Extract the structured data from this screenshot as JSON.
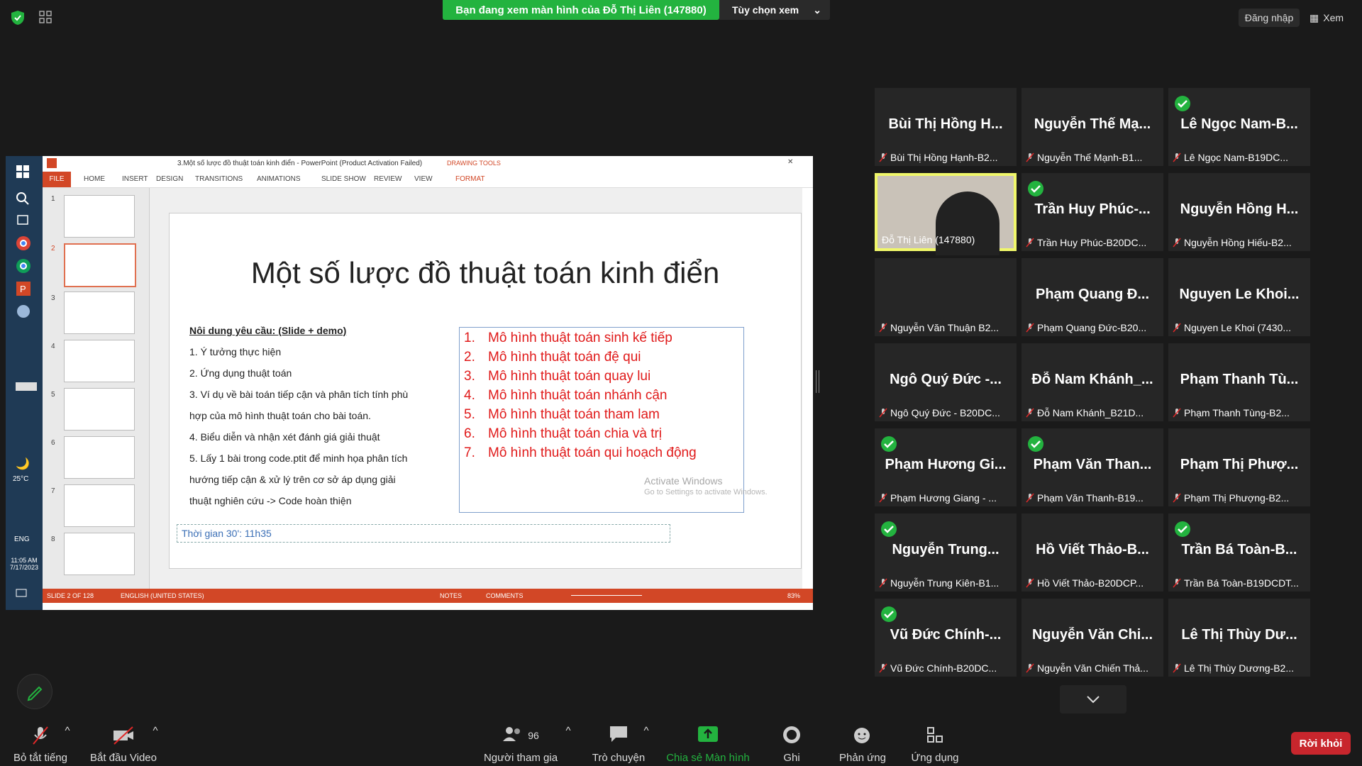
{
  "topbar": {
    "share_banner": "Bạn đang xem màn hình của Đỗ Thị Liên (147880)",
    "view_options": "Tùy chọn xem",
    "login": "Đăng nhập",
    "view": "Xem"
  },
  "powerpoint": {
    "window_title": "3.Một số lược đồ thuật toán kinh điển - PowerPoint (Product Activation Failed)",
    "drawing_tools": "DRAWING TOOLS",
    "tabs": [
      "FILE",
      "HOME",
      "INSERT",
      "DESIGN",
      "TRANSITIONS",
      "ANIMATIONS",
      "SLIDE SHOW",
      "REVIEW",
      "VIEW",
      "FORMAT"
    ],
    "slide_numbers": [
      "1",
      "2",
      "3",
      "4",
      "5",
      "6",
      "7",
      "8"
    ],
    "slide": {
      "title": "Một số lược đồ thuật toán kinh điển",
      "requirements_heading": "Nôi dung yêu cầu: (Slide + demo)",
      "requirements": [
        "1. Ý tưởng thực hiện",
        "2. Ứng dụng thuật toán",
        "3. Ví dụ về bài toán tiếp cận và phân tích tính phù",
        "hợp của mô hình thuật toán cho bài toán.",
        "4. Biểu diễn và nhận xét đánh giá giải thuật",
        "5. Lấy 1 bài trong code.ptit để minh họa phân tích",
        "hướng tiếp cận & xử lý trên cơ sở áp dụng giải",
        "thuật nghiên cứu -> Code hoàn thiện"
      ],
      "models": [
        {
          "num": "1.",
          "text": "Mô hình thuật toán sinh kế tiếp"
        },
        {
          "num": "2.",
          "text": "Mô hình thuật toán đệ qui"
        },
        {
          "num": "3.",
          "text": "Mô hình thuật toán quay lui"
        },
        {
          "num": "4.",
          "text": "Mô hình thuật toán nhánh cận"
        },
        {
          "num": "5.",
          "text": "Mô hình thuật toán tham lam"
        },
        {
          "num": "6.",
          "text": "Mô hình thuật toán chia và trị"
        },
        {
          "num": "7.",
          "text": "Mô hình thuật toán qui hoạch động"
        }
      ],
      "time_note": "Thời gian 30': 11h35"
    },
    "activate_line1": "Activate Windows",
    "activate_line2": "Go to Settings to activate Windows.",
    "status": {
      "slide_count": "SLIDE 2 OF 128",
      "language": "ENGLISH (UNITED STATES)",
      "notes": "NOTES",
      "comments": "COMMENTS",
      "zoom": "83%"
    }
  },
  "windows_taskbar": {
    "temperature": "25°C",
    "lang": "ENG",
    "time": "11:05 AM",
    "date": "7/17/2023"
  },
  "participants": [
    {
      "big": "Bùi Thị Hồng H...",
      "small": "Bùi Thị Hồng Hạnh-B2...",
      "check": false
    },
    {
      "big": "Nguyễn Thế Mạ...",
      "small": "Nguyễn Thế Mạnh-B1...",
      "check": false
    },
    {
      "big": "Lê Ngọc Nam-B...",
      "small": "Lê Ngọc Nam-B19DC...",
      "check": true
    },
    {
      "big": "",
      "small": "Đỗ Thị Liên (147880)",
      "check": false,
      "video": true
    },
    {
      "big": "Trần Huy Phúc-...",
      "small": "Trần Huy Phúc-B20DC...",
      "check": true
    },
    {
      "big": "Nguyễn Hồng H...",
      "small": "Nguyễn Hồng Hiếu-B2...",
      "check": false
    },
    {
      "big": "",
      "small": "Nguyễn Văn Thuận B2...",
      "check": false
    },
    {
      "big": "Phạm Quang  Đ...",
      "small": "Phạm Quang  Đức-B20...",
      "check": false
    },
    {
      "big": "Nguyen Le Khoi...",
      "small": "Nguyen Le Khoi (7430...",
      "check": false
    },
    {
      "big": "Ngô Quý Đức -...",
      "small": "Ngô Quý Đức - B20DC...",
      "check": false
    },
    {
      "big": "Đỗ Nam Khánh_...",
      "small": "Đỗ Nam Khánh_B21D...",
      "check": false
    },
    {
      "big": "Phạm Thanh  Tù...",
      "small": "Phạm Thanh  Tùng-B2...",
      "check": false
    },
    {
      "big": "Phạm Hương Gi...",
      "small": "Phạm Hương Giang - ...",
      "check": true
    },
    {
      "big": "Phạm Văn Than...",
      "small": "Phạm Văn Thanh-B19...",
      "check": true
    },
    {
      "big": "Phạm Thị  Phượ...",
      "small": "Phạm Thị  Phượng-B2...",
      "check": false
    },
    {
      "big": "Nguyễn Trung...",
      "small": "Nguyễn Trung Kiên-B1...",
      "check": true
    },
    {
      "big": "Hồ Viết  Thảo-B...",
      "small": "Hồ Viết  Thảo-B20DCP...",
      "check": false
    },
    {
      "big": "Trần Bá Toàn-B...",
      "small": "Trần Bá Toàn-B19DCDT...",
      "check": true
    },
    {
      "big": "Vũ Đức  Chính-...",
      "small": "Vũ Đức  Chính-B20DC...",
      "check": true
    },
    {
      "big": "Nguyễn Văn Chi...",
      "small": "Nguyễn Văn Chiến Thả...",
      "check": false
    },
    {
      "big": "Lê Thị Thùy  Dư...",
      "small": "Lê Thị Thùy  Dương-B2...",
      "check": false
    }
  ],
  "bottombar": {
    "mute": "Bỏ tắt tiếng",
    "video": "Bắt đầu Video",
    "participants": "Người tham gia",
    "participant_count": "96",
    "chat": "Trò chuyện",
    "share": "Chia sẻ Màn hình",
    "record": "Ghi",
    "reactions": "Phản ứng",
    "apps": "Ứng dụng",
    "leave": "Rời khỏi"
  },
  "colors": {
    "share_green": "#23b33f",
    "leave_red": "#c8262d",
    "ppt_orange": "#d24726",
    "model_red": "#e01a1a"
  }
}
